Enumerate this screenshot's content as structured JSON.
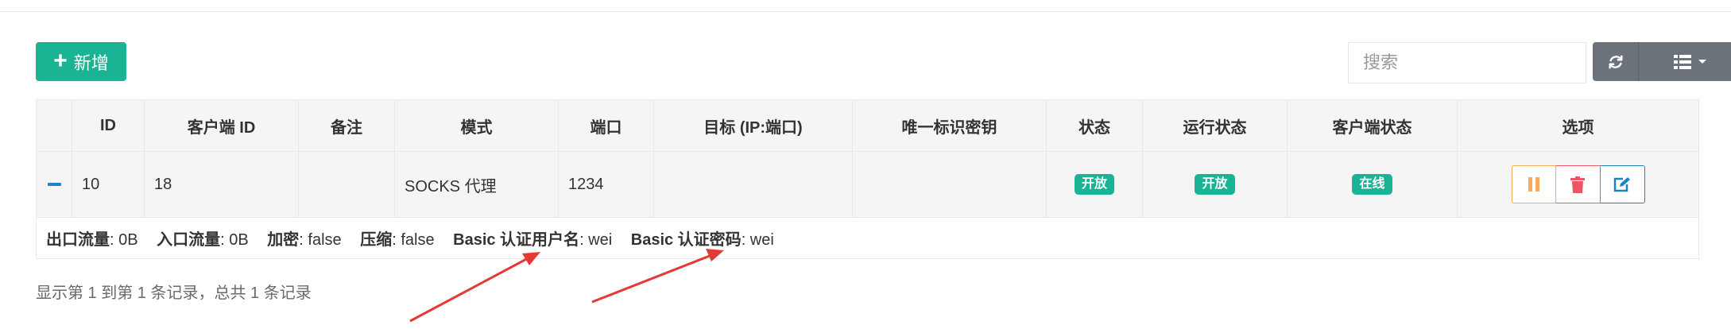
{
  "toolbar": {
    "add_label": "新增",
    "search_placeholder": "搜索"
  },
  "table": {
    "headers": [
      "",
      "ID",
      "客户端 ID",
      "备注",
      "模式",
      "端口",
      "目标 (IP:端口)",
      "唯一标识密钥",
      "状态",
      "运行状态",
      "客户端状态",
      "选项"
    ],
    "row": {
      "id": "10",
      "client_id": "18",
      "remark": "",
      "mode": "SOCKS 代理",
      "port": "1234",
      "target": "",
      "key": "",
      "status": "开放",
      "run_status": "开放",
      "client_status": "在线"
    },
    "detail": {
      "out_traffic_label": "出口流量",
      "out_traffic_value": ": 0B",
      "in_traffic_label": "入口流量",
      "in_traffic_value": ": 0B",
      "encrypt_label": "加密",
      "encrypt_value": ": false",
      "compress_label": "压缩",
      "compress_value": ": false",
      "basic_user_label": "Basic 认证用户名",
      "basic_user_value": ": wei",
      "basic_pass_label": "Basic 认证密码",
      "basic_pass_value": ": wei"
    }
  },
  "pagination": {
    "info": "显示第 1 到第 1 条记录，总共 1 条记录"
  },
  "colors": {
    "primary": "#1ab394",
    "warning": "#f8ac59",
    "danger": "#ed5565",
    "info": "#1c84c6",
    "annotation": "#e53935"
  }
}
